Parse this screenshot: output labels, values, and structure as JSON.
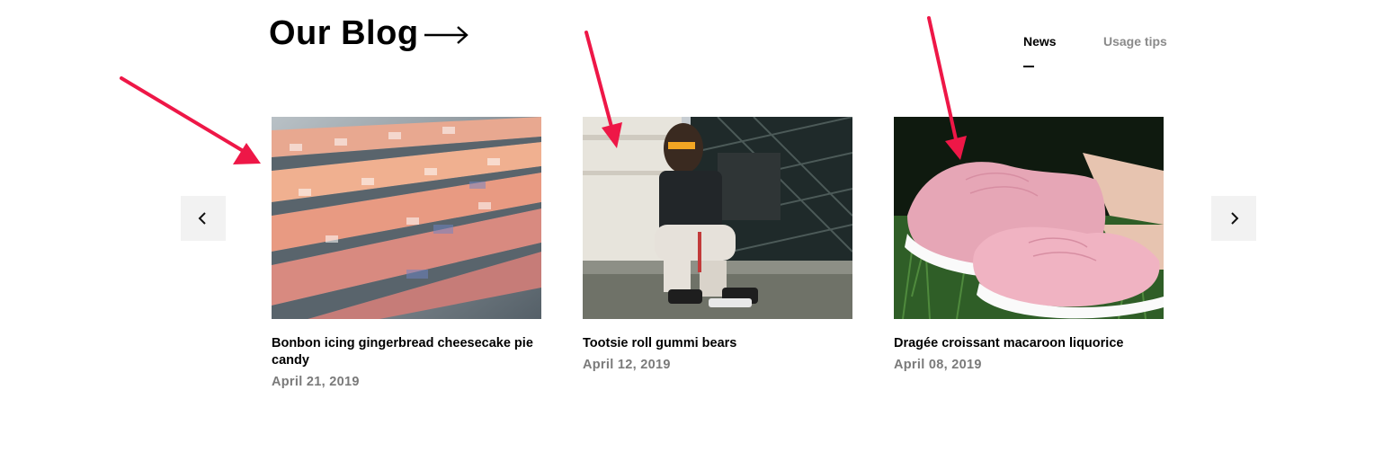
{
  "header": {
    "title": "Our Blog"
  },
  "tabs": [
    {
      "label": "News",
      "active": true
    },
    {
      "label": "Usage tips",
      "active": false
    }
  ],
  "posts": [
    {
      "title": "Bonbon icing gingerbread cheesecake pie candy",
      "date": "April 21, 2019",
      "image": "sneaker-store-shelves"
    },
    {
      "title": "Tootsie roll gummi bears",
      "date": "April 12, 2019",
      "image": "man-crouching-sunglasses"
    },
    {
      "title": "Dragée croissant macaroon liquorice",
      "date": "April 08, 2019",
      "image": "pink-sneakers-grass"
    }
  ],
  "carousel": {
    "prev_icon": "chevron-left-icon",
    "next_icon": "chevron-right-icon"
  },
  "colors": {
    "text": "#000000",
    "muted": "#8a8a8a",
    "button_bg": "#f2f2f2",
    "annotation_arrow": "#ee1747"
  }
}
